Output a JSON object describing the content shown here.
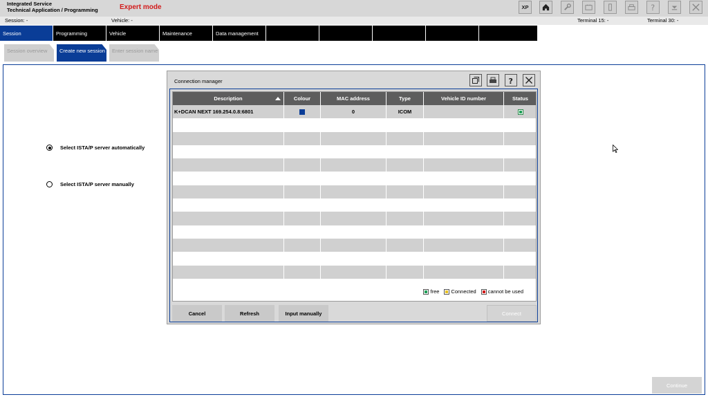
{
  "titlebar": {
    "app_line1": "Integrated Service",
    "app_line2": "Technical Application / Programming",
    "mode": "Expert mode",
    "xp_label": "XP",
    "buttons": [
      "home-icon",
      "wrench-icon",
      "battery-icon",
      "phone-icon",
      "printer-icon",
      "help-icon",
      "minimize-icon",
      "close-icon"
    ]
  },
  "session_row": {
    "session": "Session:  -",
    "vehicle": "Vehicle:  -",
    "terminal15": "Terminal 15:  -",
    "terminal30": "Terminal 30:  -"
  },
  "main_nav": {
    "items": [
      {
        "label": "Session",
        "active": true
      },
      {
        "label": "Programming"
      },
      {
        "label": "Vehicle"
      },
      {
        "label": "Maintenance"
      },
      {
        "label": "Data management"
      },
      {
        "label": ""
      },
      {
        "label": ""
      },
      {
        "label": ""
      },
      {
        "label": ""
      },
      {
        "label": ""
      }
    ]
  },
  "sub_nav": {
    "items": [
      {
        "label": "Session overview"
      },
      {
        "label": "Create new session",
        "active": true
      },
      {
        "label": "Enter session name"
      }
    ]
  },
  "content": {
    "radio_auto": "Select ISTA/P server automatically",
    "radio_manual": "Select ISTA/P server manually",
    "continue": "Continue"
  },
  "dialog": {
    "title": "Connection manager",
    "columns": [
      "Description",
      "Colour",
      "MAC address",
      "Type",
      "Vehicle ID number",
      "Status"
    ],
    "rows": [
      {
        "description": "K+DCAN NEXT 169.254.0.8:6801",
        "colour": "#0a3d97",
        "mac": "0",
        "type": "ICOM",
        "vin": "",
        "status": "free"
      }
    ],
    "legend": {
      "free": "free",
      "connected": "Connected",
      "cannot": "cannot be used"
    },
    "colors": {
      "free": "#1fa058",
      "connected": "#e8c020",
      "cannot": "#d21c1c"
    },
    "buttons": {
      "cancel": "Cancel",
      "refresh": "Refresh",
      "input": "Input manually",
      "connect": "Connect"
    }
  }
}
